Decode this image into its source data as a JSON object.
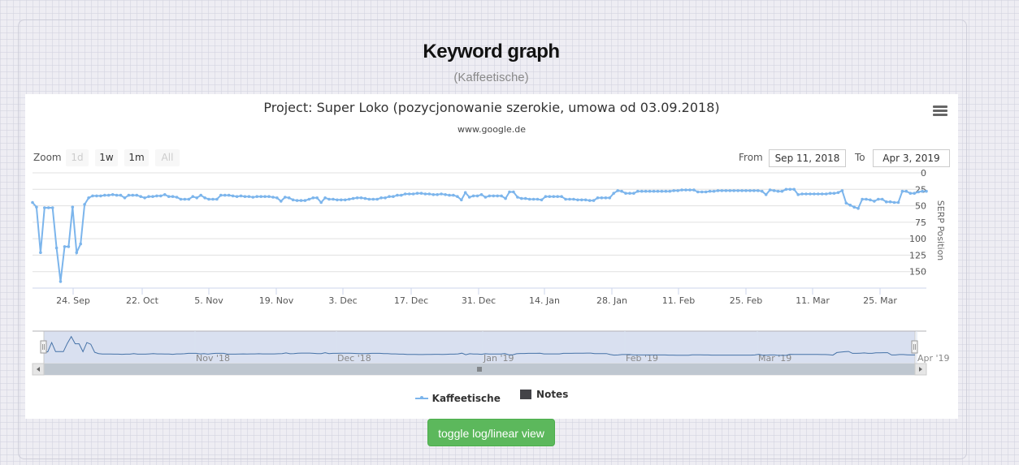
{
  "page": {
    "title": "Keyword graph",
    "subtitle": "(Kaffeetische)"
  },
  "chart": {
    "title": "Project: Super Loko (pozycjonowanie szerokie, umowa od 03.09.2018)",
    "subtitle": "www.google.de",
    "menu_icon": "hamburger-menu-icon",
    "zoom": {
      "label": "Zoom",
      "buttons": [
        {
          "label": "1d",
          "enabled": false
        },
        {
          "label": "1w",
          "enabled": true
        },
        {
          "label": "1m",
          "enabled": true
        },
        {
          "label": "All",
          "enabled": false
        }
      ]
    },
    "range": {
      "from_label": "From",
      "from_value": "Sep 11, 2018",
      "to_label": "To",
      "to_value": "Apr 3, 2019"
    },
    "legend": [
      {
        "name": "Kaffeetische",
        "color": "#7cb5ec",
        "symbol": "line"
      },
      {
        "name": "Notes",
        "color": "#434348",
        "symbol": "square"
      }
    ],
    "navigator_labels": [
      "Nov '18",
      "Dec '18",
      "Jan '19",
      "Feb '19",
      "Mar '19",
      "Apr '19"
    ]
  },
  "toggle_button": {
    "label": "toggle log/linear view",
    "color": "#5cb85c"
  },
  "chart_data": {
    "type": "line",
    "title": "Project: Super Loko (pozycjonowanie szerokie, umowa od 03.09.2018)",
    "subtitle": "www.google.de",
    "xlabel": "",
    "ylabel": "SERP Position",
    "y_reversed": true,
    "ylim": [
      0,
      175
    ],
    "y_ticks": [
      0,
      25,
      50,
      75,
      100,
      125,
      150
    ],
    "x_tick_labels": [
      "24. Sep",
      "22. Oct",
      "5. Nov",
      "19. Nov",
      "3. Dec",
      "17. Dec",
      "31. Dec",
      "14. Jan",
      "28. Jan",
      "11. Feb",
      "25. Feb",
      "11. Mar",
      "25. Mar"
    ],
    "x_range": [
      "Sep 11, 2018",
      "Apr 3, 2019"
    ],
    "grid": true,
    "legend_position": "bottom",
    "series": [
      {
        "name": "Kaffeetische",
        "color": "#7cb5ec",
        "values": [
          45,
          52,
          121,
          53,
          53,
          53,
          114,
          165,
          112,
          112,
          52,
          121,
          108,
          48,
          38,
          35,
          35,
          35,
          34,
          34,
          33,
          34,
          34,
          38,
          34,
          34,
          34,
          36,
          38,
          36,
          36,
          35,
          35,
          33,
          36,
          36,
          37,
          40,
          40,
          40,
          36,
          38,
          34,
          38,
          40,
          40,
          40,
          34,
          34,
          34,
          35,
          36,
          35,
          36,
          36,
          37,
          36,
          36,
          36,
          36,
          37,
          38,
          43,
          37,
          38,
          41,
          42,
          42,
          42,
          40,
          38,
          38,
          45,
          38,
          40,
          40,
          41,
          41,
          41,
          40,
          39,
          38,
          38,
          39,
          40,
          40,
          40,
          38,
          38,
          36,
          36,
          34,
          34,
          32,
          32,
          32,
          31,
          31,
          32,
          32,
          33,
          33,
          32,
          33,
          34,
          34,
          36,
          41,
          30,
          37,
          35,
          35,
          33,
          37,
          35,
          35,
          35,
          35,
          39,
          29,
          29,
          37,
          39,
          39,
          40,
          40,
          40,
          41,
          36,
          36,
          36,
          36,
          36,
          40,
          40,
          40,
          41,
          41,
          41,
          42,
          42,
          38,
          38,
          38,
          38,
          31,
          27,
          28,
          31,
          31,
          31,
          28,
          28,
          28,
          28,
          28,
          28,
          28,
          28,
          28,
          27,
          27,
          26,
          26,
          26,
          26,
          29,
          29,
          29,
          28,
          28,
          27,
          27,
          27,
          27,
          27,
          27,
          27,
          27,
          27,
          27,
          27,
          28,
          33,
          26,
          27,
          28,
          28,
          25,
          25,
          25,
          33,
          32,
          32,
          32,
          32,
          32,
          32,
          32,
          31,
          31,
          30,
          27,
          46,
          49,
          52,
          54,
          40,
          40,
          41,
          43,
          40,
          40,
          44,
          44,
          45,
          45,
          28,
          28,
          31,
          31,
          29,
          28,
          28
        ]
      },
      {
        "name": "Notes",
        "color": "#434348",
        "values": []
      }
    ]
  }
}
